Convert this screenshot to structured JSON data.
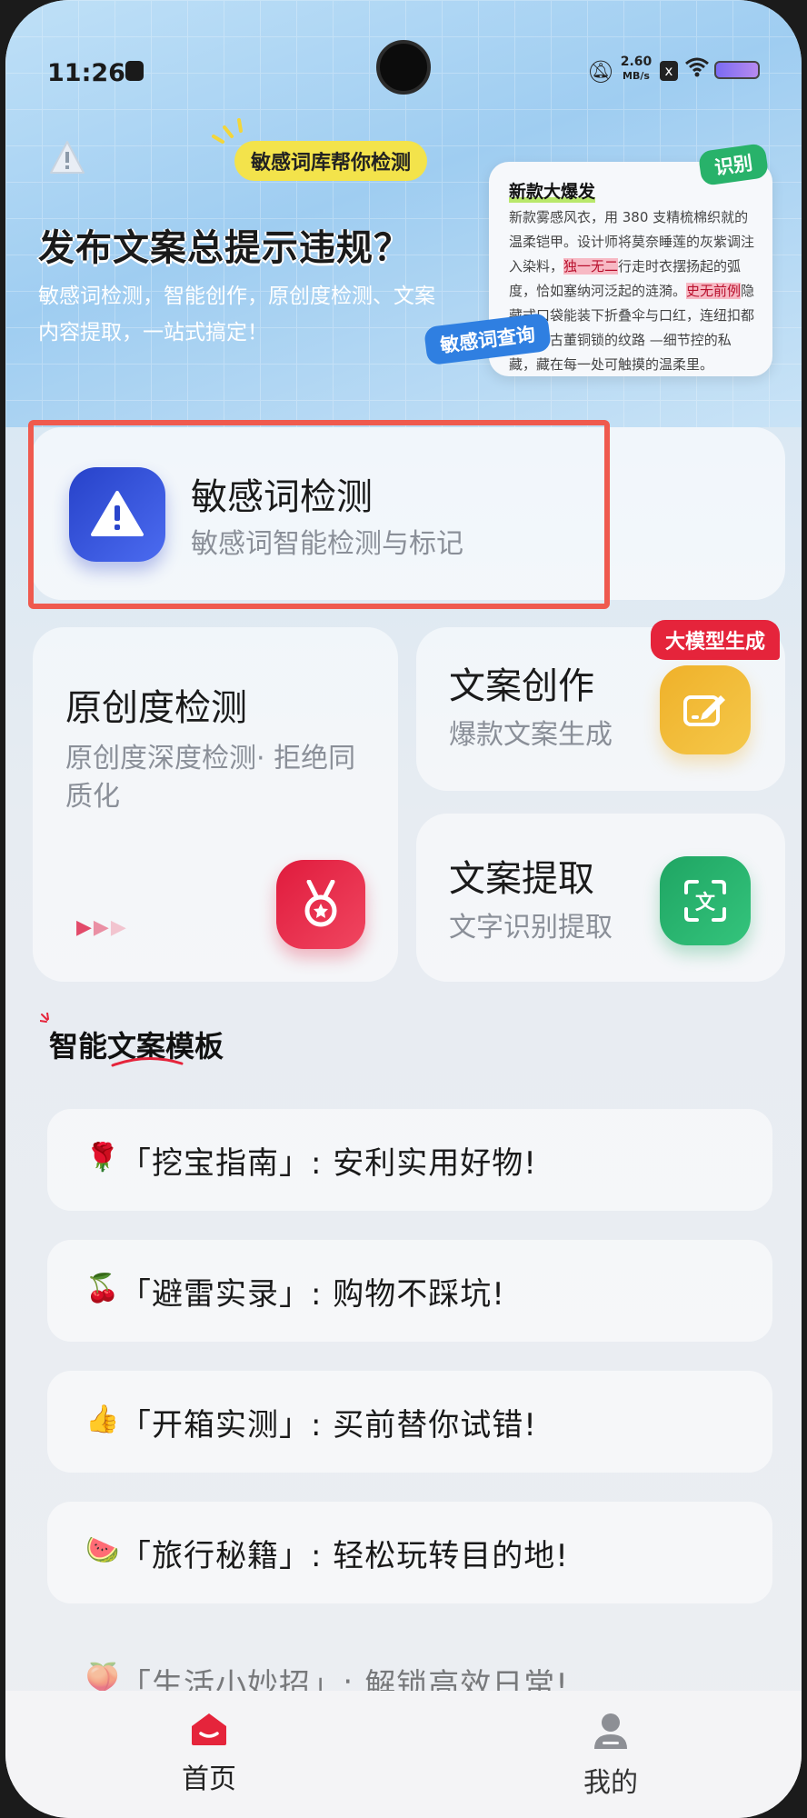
{
  "status_bar": {
    "time": "11:26",
    "net_speed_value": "2.60",
    "net_speed_unit": "MB/s"
  },
  "hero": {
    "bubble": "敏感词库帮你检测",
    "title": "发布文案总提示违规？",
    "description": "敏感词检测，智能创作，原创度检测、文案内容提取，一站式搞定！",
    "tag_recognize": "识别",
    "tag_query": "敏感词查询",
    "sample": {
      "title": "新款大爆发",
      "text_before_1": "新款雾感风衣，用 380 支精梳棉织就的温柔铠甲。设计师将莫奈睡莲的灰紫调注入染料，",
      "highlight_1": "独一无二",
      "text_between": "行走时衣摆扬起的弧度，恰如塞纳河泛起的涟漪。",
      "highlight_2": "史无前例",
      "text_after": "隐藏式口袋能装下折叠伞与口红，连纽扣都复刻了古董铜锁的纹路 —细节控的私藏，藏在每一处可触摸的温柔里。"
    }
  },
  "features": {
    "sensitive": {
      "title": "敏感词检测",
      "subtitle": "敏感词智能检测与标记",
      "icon": "warning-triangle-icon"
    },
    "originality": {
      "title": "原创度检测",
      "subtitle": "原创度深度检测· 拒绝同质化",
      "icon": "medal-icon"
    },
    "copywriting": {
      "title": "文案创作",
      "subtitle": "爆款文案生成",
      "badge": "大模型生成",
      "icon": "edit-icon"
    },
    "extract": {
      "title": "文案提取",
      "subtitle": "文字识别提取",
      "icon": "text-scan-icon"
    }
  },
  "templates_section": {
    "title": "智能文案模板",
    "items": [
      {
        "emoji": "🌹",
        "text": "「挖宝指南」: 安利实用好物!"
      },
      {
        "emoji": "🍒",
        "text": "「避雷实录」: 购物不踩坑!"
      },
      {
        "emoji": "👍",
        "text": "「开箱实测」: 买前替你试错!"
      },
      {
        "emoji": "🍉",
        "text": "「旅行秘籍」: 轻松玩转目的地!"
      },
      {
        "emoji": "🍑",
        "text": "「生活小妙招」: 解锁高效日常!"
      }
    ]
  },
  "bottom_nav": {
    "home": "首页",
    "mine": "我的"
  },
  "colors": {
    "accent_red": "#e5243b",
    "highlight_border": "#ef5a4e",
    "blue_tile": "#2742c9",
    "orange_tile": "#efb12a",
    "green_tile": "#1fa563"
  }
}
